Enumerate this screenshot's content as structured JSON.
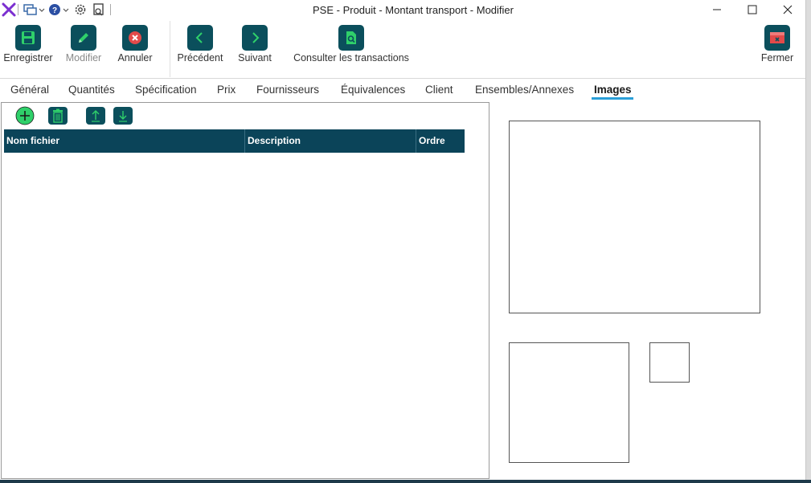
{
  "window": {
    "title": "PSE - Produit - Montant transport - Modifier"
  },
  "toolbar": {
    "save_label": "Enregistrer",
    "edit_label": "Modifier",
    "cancel_label": "Annuler",
    "previous_label": "Précédent",
    "next_label": "Suivant",
    "transactions_label": "Consulter les transactions",
    "close_label": "Fermer"
  },
  "tabs": [
    {
      "label": "Général"
    },
    {
      "label": "Quantités"
    },
    {
      "label": "Spécification"
    },
    {
      "label": "Prix"
    },
    {
      "label": "Fournisseurs"
    },
    {
      "label": "Équivalences"
    },
    {
      "label": "Client"
    },
    {
      "label": "Ensembles/Annexes"
    },
    {
      "label": "Images"
    }
  ],
  "active_tab": "Images",
  "images_grid": {
    "columns": [
      "Nom fichier",
      "Description",
      "Ordre"
    ],
    "rows": []
  },
  "colors": {
    "accent": "#0b4f5c",
    "header": "#0b4459",
    "tab_underline": "#2a9fd8",
    "add_green": "#2fd06a",
    "brand_purple": "#7b2fd0"
  }
}
